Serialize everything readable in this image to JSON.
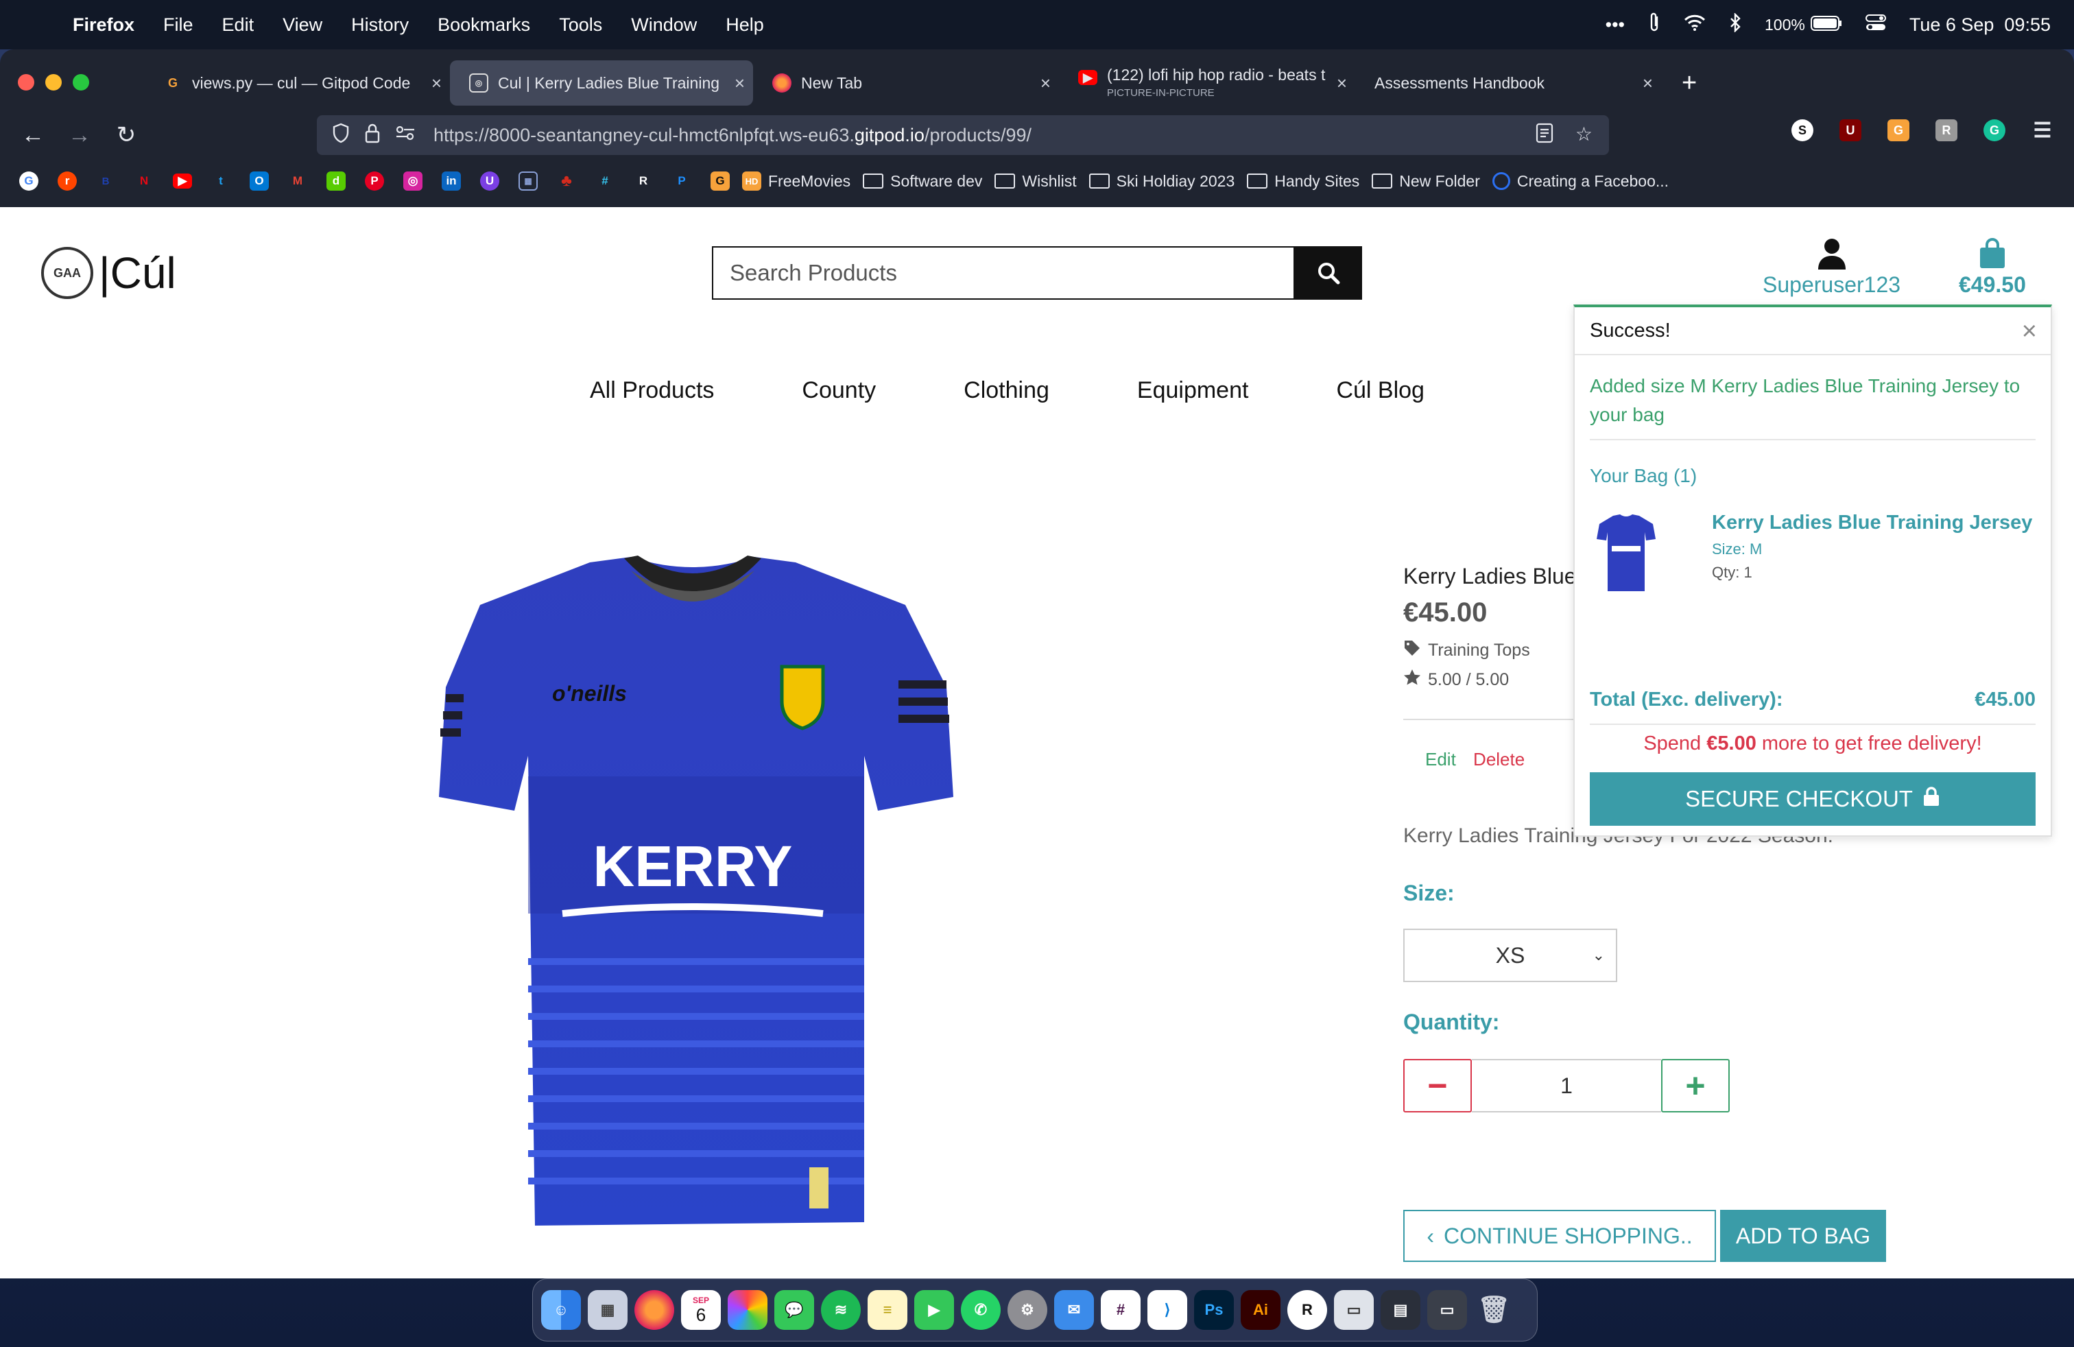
{
  "menubar": {
    "app_name": "Firefox",
    "items": [
      "File",
      "Edit",
      "View",
      "History",
      "Bookmarks",
      "Tools",
      "Window",
      "Help"
    ],
    "battery": "100%",
    "datetime": "Tue 6 Sep  09:55"
  },
  "tabs": [
    {
      "title": "views.py — cul — Gitpod Code",
      "icon": "gitpod-icon"
    },
    {
      "title": "Cul | Kerry Ladies Blue Training",
      "icon": "site-icon"
    },
    {
      "title": "New Tab",
      "icon": "firefox-icon"
    },
    {
      "title": "(122) lofi hip hop radio - beats t",
      "subtitle": "PICTURE-IN-PICTURE",
      "icon": "youtube-icon"
    },
    {
      "title": "Assessments Handbook",
      "icon": ""
    }
  ],
  "urlbar": {
    "url_prefix": "https://8000-seantangney-cul-hmct6nlpfqt.ws-eu63.",
    "url_domain": "gitpod.io",
    "url_suffix": "/products/99/"
  },
  "bookmarks": [
    "FreeMovies",
    "Software dev",
    "Wishlist",
    "Ski Holdiay 2023",
    "Handy Sites",
    "New Folder",
    "Creating a Faceboo..."
  ],
  "site": {
    "logo_text": "|Cúl",
    "logo_seal": "GAA",
    "search_placeholder": "Search Products",
    "account_label": "Superuser123",
    "bag_total": "€49.50",
    "nav": [
      "All Products",
      "County",
      "Clothing",
      "Equipment",
      "Cúl Blog"
    ]
  },
  "product": {
    "title": "Kerry Ladies Blue",
    "price": "€45.00",
    "category": "Training Tops",
    "rating": "5.00 / 5.00",
    "edit_label": "Edit",
    "delete_label": "Delete",
    "description": "Kerry Ladies Training Jersey For 2022 Season.",
    "size_label": "Size:",
    "size_value": "XS",
    "quantity_label": "Quantity:",
    "quantity_value": "1",
    "continue_label": "CONTINUE SHOPPING..",
    "add_label": "ADD TO BAG",
    "jersey_text": "KERRY",
    "jersey_brand": "o'neills"
  },
  "toast": {
    "header": "Success!",
    "message": "Added size M Kerry Ladies Blue Training Jersey to your bag",
    "bag_heading": "Your Bag (1)",
    "item_name": "Kerry Ladies Blue Training Jersey",
    "item_size": "Size: M",
    "item_qty": "Qty: 1",
    "total_label": "Total (Exc. delivery):",
    "total_value": "€45.00",
    "spend_pre": "Spend ",
    "spend_amount": "€5.00",
    "spend_post": " more to get free delivery!",
    "checkout_label": "SECURE CHECKOUT"
  },
  "colors": {
    "accent": "#3a9ca8",
    "success": "#3aa06b",
    "danger": "#d9364a",
    "jersey_blue": "#2b3fc6"
  },
  "dock": {
    "calendar_month": "SEP",
    "calendar_day": "6"
  }
}
